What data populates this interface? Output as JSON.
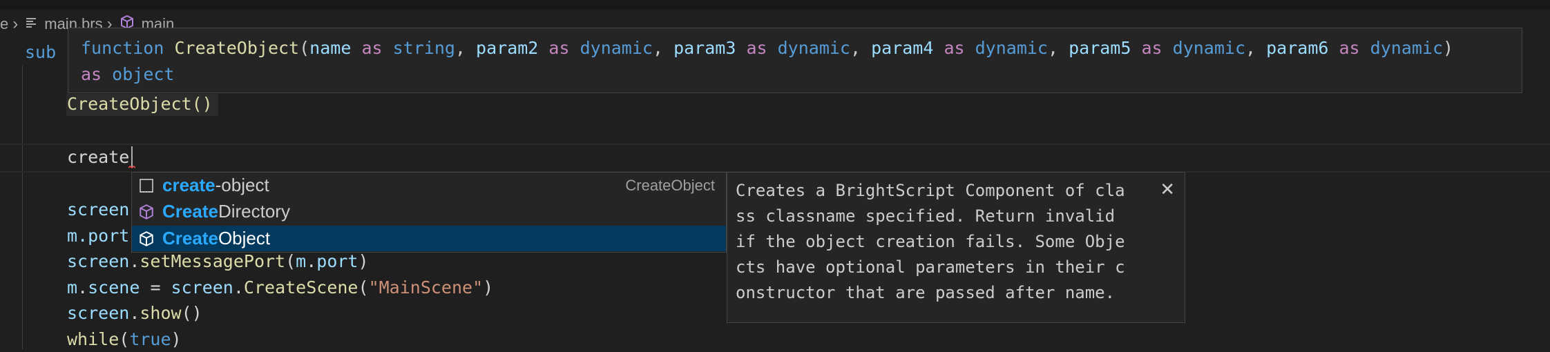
{
  "breadcrumb": {
    "partial_left": "e",
    "file": "main.brs",
    "symbol": "main"
  },
  "code": {
    "l1_kw": "sub",
    "l3": "CreateObject()",
    "l4": "create",
    "l6_fragment": "screen",
    "l7_m": "m",
    "l7_rest": ".port",
    "l8_screen": "screen",
    "l8_method": "setMessagePort",
    "l8_m": "m",
    "l8_port": "port",
    "l9_m": "m",
    "l9_scene": "scene",
    "l9_eq": " = ",
    "l9_screen": "screen",
    "l9_method": "CreateScene",
    "l9_str": "\"MainScene\"",
    "l10_screen": "screen",
    "l10_method": "show",
    "l11_kw": "while",
    "l11_val": "true"
  },
  "signature": {
    "keyword": "function",
    "name": "CreateObject",
    "params": [
      {
        "name": "name",
        "type": "string"
      },
      {
        "name": "param2",
        "type": "dynamic"
      },
      {
        "name": "param3",
        "type": "dynamic"
      },
      {
        "name": "param4",
        "type": "dynamic"
      },
      {
        "name": "param5",
        "type": "dynamic"
      },
      {
        "name": "param6",
        "type": "dynamic"
      }
    ],
    "as_kw": "as",
    "return_type": "object"
  },
  "suggestions": [
    {
      "match": "create",
      "rest": "-object",
      "detail": "CreateObject",
      "icon": "snippet-icon",
      "selected": false
    },
    {
      "match": "Create",
      "rest": "Directory",
      "detail": "",
      "icon": "method-cube-icon",
      "selected": false
    },
    {
      "match": "Create",
      "rest": "Object",
      "detail": "",
      "icon": "method-cube-icon",
      "selected": true
    }
  ],
  "docs": {
    "lines": [
      "Creates a BrightScript Component of cla",
      "ss classname specified. Return invalid",
      "if the object creation fails. Some Obje",
      "cts have optional parameters in their c",
      "onstructor that are passed after name."
    ],
    "close_glyph": "✕"
  },
  "colors": {
    "accent": "#2aaaff",
    "selection": "#04395e",
    "keyword": "#569cd6",
    "function": "#dcdcaa",
    "variable": "#9cdcfe",
    "string": "#ce9178",
    "purple": "#c586c0"
  }
}
